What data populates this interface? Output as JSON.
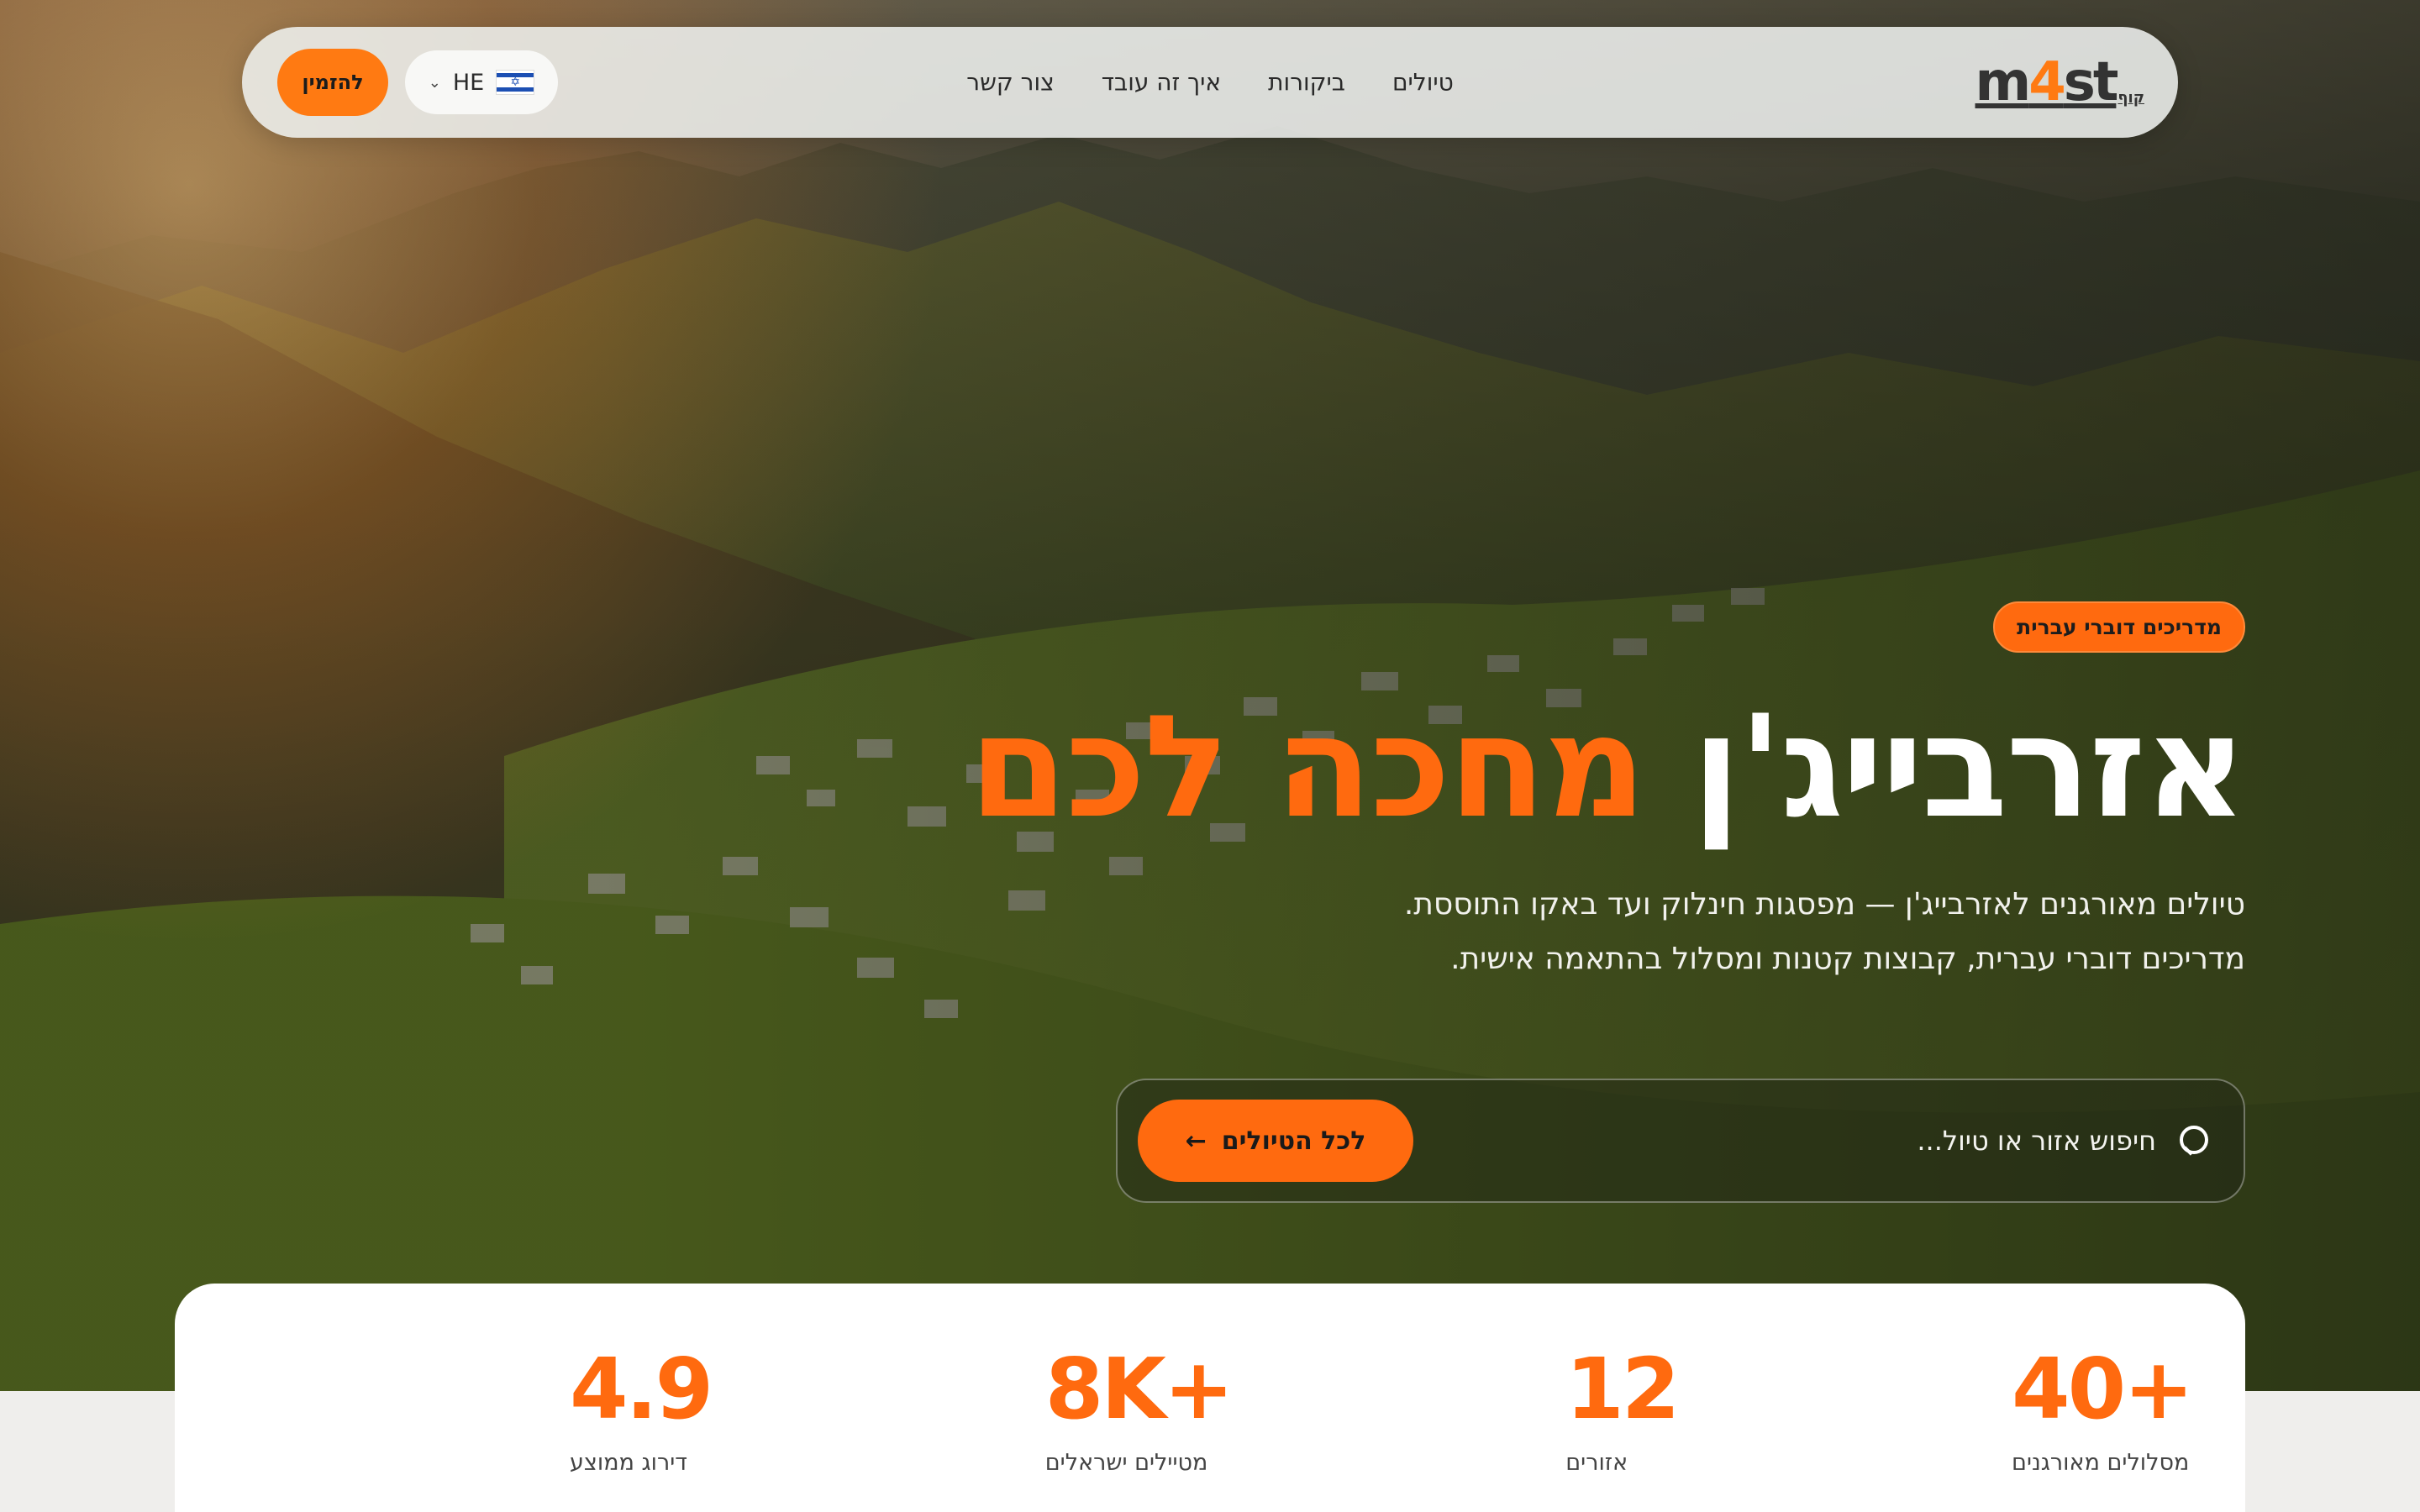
{
  "nav": {
    "logo": {
      "main_a": "m",
      "main_b": "4",
      "main_c": "st",
      "sub": "קוף"
    },
    "links": [
      "טיולים",
      "ביקורות",
      "איך זה עובד",
      "צור קשר"
    ],
    "language": {
      "code": "HE",
      "flag_icon": "israel-flag-icon"
    },
    "book_label": "להזמין"
  },
  "hero": {
    "badge": "מדריכים דוברי עברית",
    "headline_main": "אזרבייג'ן",
    "headline_accent": "מחכה לכם",
    "subtitle_line1": "טיולים מאורגנים לאזרבייג'ן — מפסגות חינלוק ועד באקו התוססת.",
    "subtitle_line2": "מדריכים דוברי עברית, קבוצות קטנות ומסלול בהתאמה אישית."
  },
  "search": {
    "placeholder": "חיפוש אזור או טיול...",
    "button_label": "לכל הטיולים"
  },
  "stats": [
    {
      "value": "+40",
      "label": "מסלולים מאורגנים"
    },
    {
      "value": "12",
      "label": "אזורים"
    },
    {
      "value": "+8K",
      "label": "מטיילים ישראלים"
    },
    {
      "value": "4.9",
      "label": "דירוג ממוצע"
    }
  ],
  "colors": {
    "accent": "#ff6a0f",
    "nav_bg": "#eef0ee",
    "card_bg": "#ffffff"
  }
}
